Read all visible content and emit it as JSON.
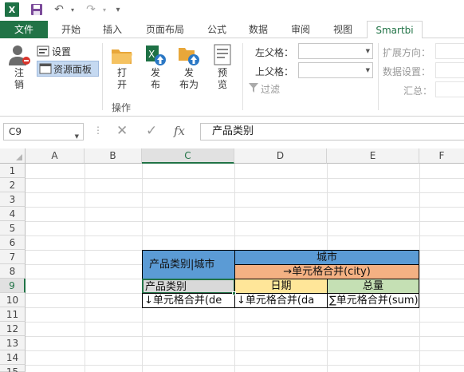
{
  "tabs": [
    {
      "label": "文件"
    },
    {
      "label": "开始"
    },
    {
      "label": "插入"
    },
    {
      "label": "页面布局"
    },
    {
      "label": "公式"
    },
    {
      "label": "数据"
    },
    {
      "label": "审阅"
    },
    {
      "label": "视图"
    },
    {
      "label": "Smartbi"
    }
  ],
  "active_tab": "Smartbi",
  "ribbon": {
    "logout_label": "注\n销",
    "settings_label": "设置",
    "resource_panel_label": "资源面板",
    "open_label": "打\n开",
    "publish_label": "发\n布",
    "publish_as_label": "发\n布为",
    "preview_label": "预\n览",
    "group_operations": "操作",
    "left_parent_label": "左父格：",
    "left_parent_value": "",
    "top_parent_label": "上父格：",
    "top_parent_value": "",
    "filter_label": "过滤",
    "expand_direction_label": "扩展方向：",
    "data_settings_label": "数据设置：",
    "summary_label": "汇总："
  },
  "formula_bar": {
    "name_box": "C9",
    "formula": "产品类别"
  },
  "grid": {
    "columns": [
      "A",
      "B",
      "C",
      "D",
      "E",
      "F"
    ],
    "rows": [
      "1",
      "2",
      "3",
      "4",
      "5",
      "6",
      "7",
      "8",
      "9",
      "10",
      "11",
      "12",
      "13",
      "14",
      "15"
    ],
    "selected_column": "C",
    "selected_row": "9",
    "cells": {
      "c7": "产品类别|城市",
      "d7": "城市",
      "d8": "→单元格合并(city)",
      "c9": "产品类别",
      "d9": "日期",
      "e9": "总量",
      "c10": "↓单元格合并(de",
      "d10": "↓单元格合并(da",
      "e10": "∑单元格合并(sum)"
    }
  },
  "colors": {
    "excel_green": "#217346",
    "header_blue": "#5b9bd5",
    "salmon": "#f4b183",
    "gray": "#d9d9d9",
    "yellow": "#ffe699",
    "green_light": "#c5e0b4"
  }
}
